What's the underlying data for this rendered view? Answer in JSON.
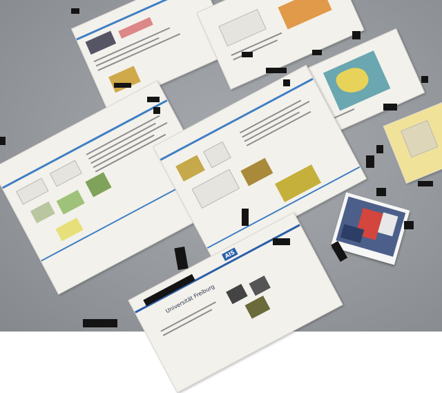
{
  "scene": {
    "description_visible_text": {
      "poster_lower_label": "Universität Freiburg",
      "poster_lower_logo": "AIS"
    },
    "colors": {
      "table": "#9a9ea2",
      "paper": "#f3f1ec",
      "tape": "#141414",
      "accent_blue": "#3f7fc4",
      "map_yellow": "#e8d35a",
      "map_teal": "#6aa7b0"
    }
  }
}
